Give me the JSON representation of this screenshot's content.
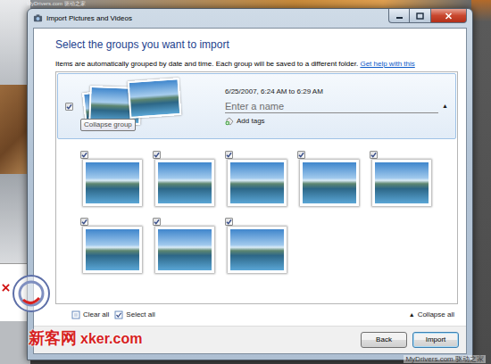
{
  "watermarks": {
    "top": "MyDrivers.com 驱动之家",
    "bottom_right": "MyDrivers.com 驱动之家",
    "bottom_left_cn": "新客网",
    "bottom_left_en": "xker.com"
  },
  "window": {
    "title": "Import Pictures and Videos"
  },
  "heading": "Select the groups you want to import",
  "description": "Items are automatically grouped by date and time. Each group will be saved to a different folder.",
  "help_link": "Get help with this",
  "groups": [
    {
      "checked": true,
      "expanded": true,
      "date_range": "6/25/2007, 6:24 AM to 6:29 AM",
      "name_placeholder": "Enter a name",
      "add_tags": "Add tags",
      "tooltip": "Collapse group",
      "toggle": "▲",
      "items": [
        {
          "checked": true
        },
        {
          "checked": true
        },
        {
          "checked": true
        },
        {
          "checked": true
        },
        {
          "checked": true
        },
        {
          "checked": true
        },
        {
          "checked": true
        },
        {
          "checked": true
        }
      ]
    }
  ],
  "footer": {
    "clear_all": "Clear all",
    "select_all": "Select all",
    "collapse_icon": "▲",
    "collapse_all": "Collapse all"
  },
  "buttons": [
    {
      "label": "Back",
      "default": false
    },
    {
      "label": "Import",
      "default": true
    }
  ]
}
